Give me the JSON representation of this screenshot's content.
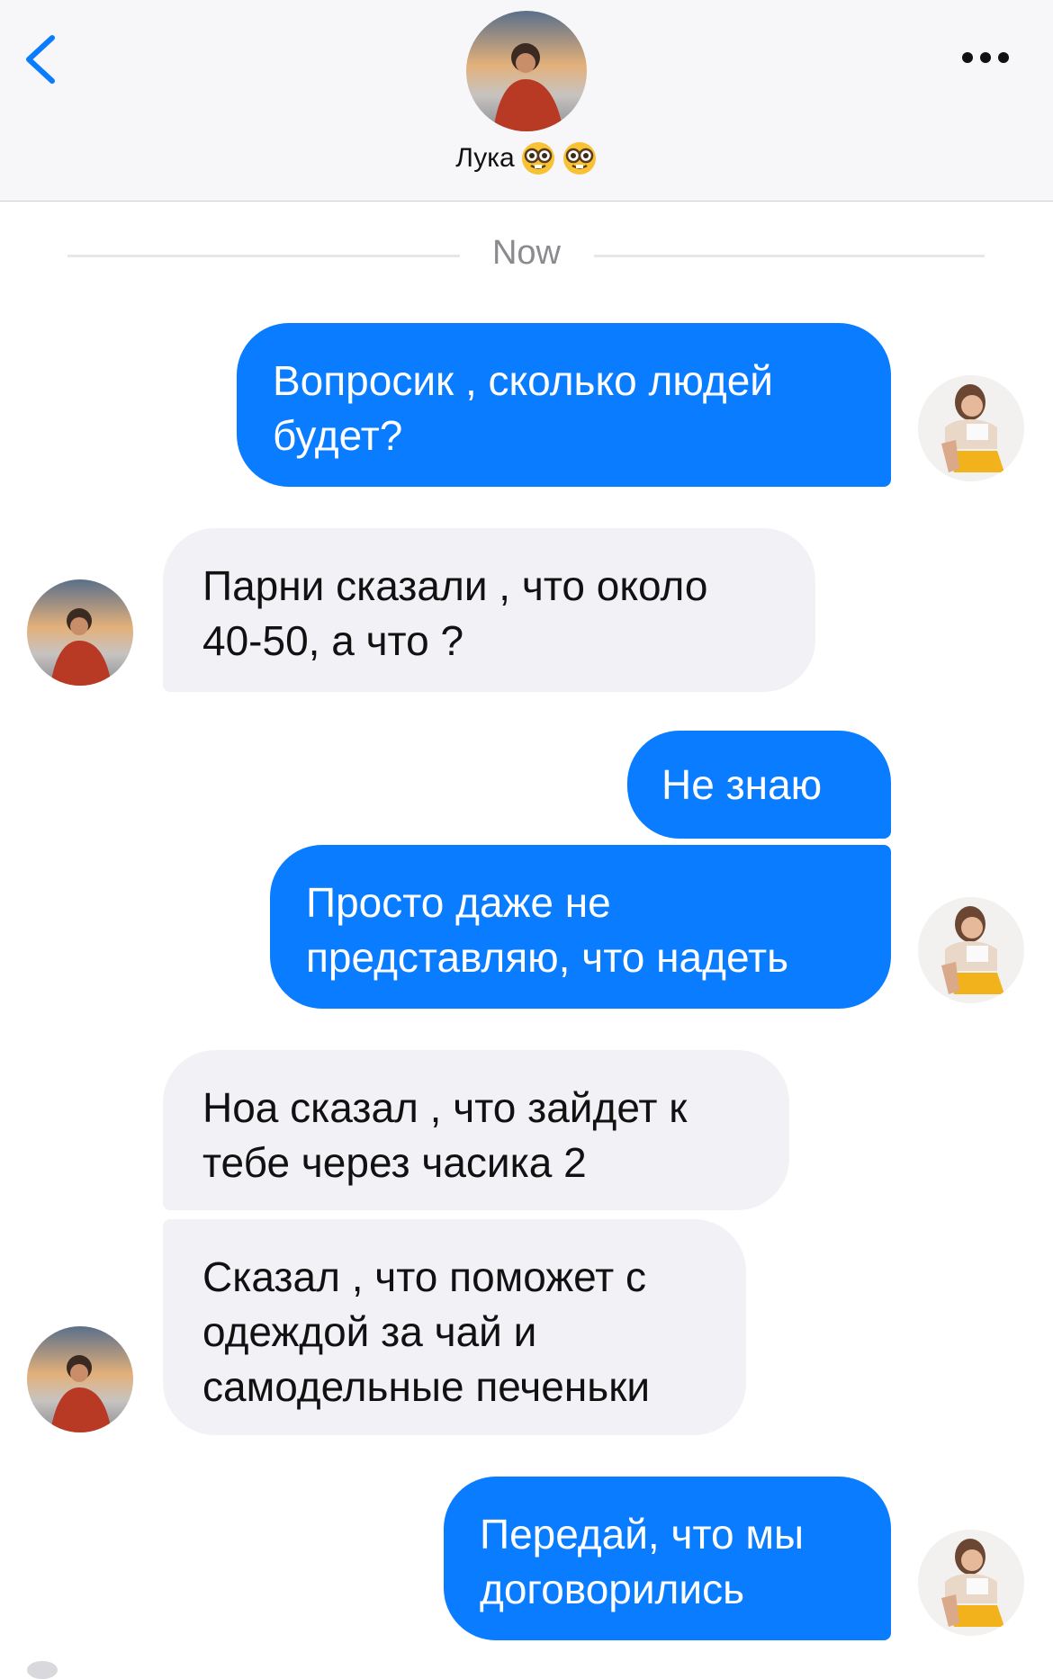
{
  "header": {
    "contact_name": "Лука",
    "emojis": [
      "nerd-face-emoji",
      "nerd-face-emoji"
    ],
    "back_icon": "chevron-left-icon",
    "more_icon": "ellipsis-icon"
  },
  "timestamp": "Now",
  "messages": [
    {
      "direction": "out",
      "lines": [
        "Вопросик , сколько людей",
        "будет?"
      ]
    },
    {
      "direction": "in",
      "lines": [
        "Парни сказали , что около",
        "40-50, а что ?"
      ]
    },
    {
      "direction": "out",
      "lines": [
        "Не знаю"
      ]
    },
    {
      "direction": "out",
      "lines": [
        "Просто даже не",
        "представляю, что надеть"
      ]
    },
    {
      "direction": "in",
      "lines": [
        "Ноа сказал , что зайдет к",
        "тебе через часика 2"
      ]
    },
    {
      "direction": "in",
      "lines": [
        "Сказал , что поможет с",
        "одеждой за чай и",
        "самодельные печеньки"
      ]
    },
    {
      "direction": "out",
      "lines": [
        "Передай, что мы",
        "договорились"
      ]
    }
  ],
  "colors": {
    "outgoing_bubble": "#0a7cff",
    "incoming_bubble": "#f2f1f6",
    "accent": "#0a7cff",
    "header_bg": "#f7f6f8"
  }
}
